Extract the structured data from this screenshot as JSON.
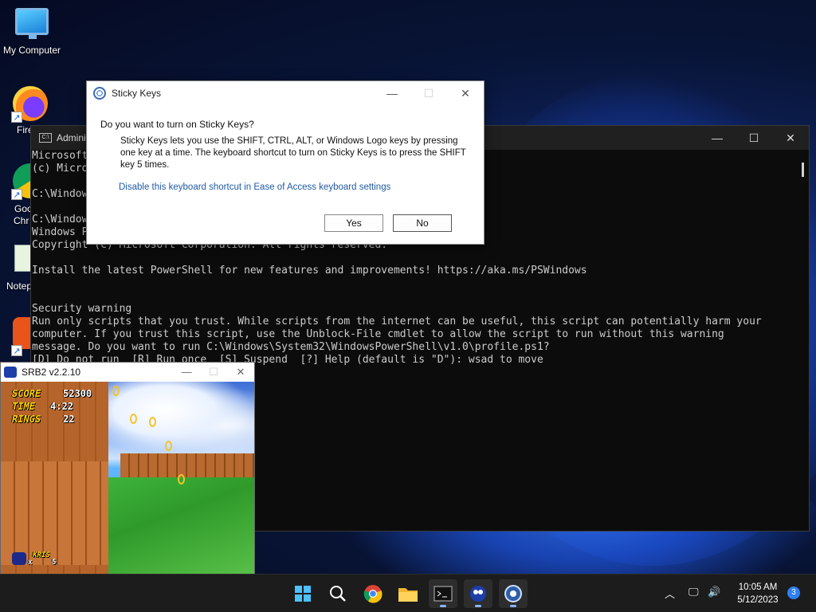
{
  "desktop": {
    "icons": [
      {
        "label": "My Computer"
      },
      {
        "label": "Fire"
      },
      {
        "label": "Goo"
      },
      {
        "label": "Chr"
      },
      {
        "label": "Notep"
      }
    ]
  },
  "terminal": {
    "title": "Admini",
    "lines": [
      "Microsoft",
      "(c) Micro",
      "",
      "C:\\Windows",
      "",
      "C:\\Window",
      "Windows P",
      "Copyright (C) Microsoft Corporation. All rights reserved.",
      "",
      "Install the latest PowerShell for new features and improvements! https://aka.ms/PSWindows",
      "",
      "",
      "Security warning",
      "Run only scripts that you trust. While scripts from the internet can be useful, this script can potentially harm your",
      "computer. If you trust this script, use the Unblock-File cmdlet to allow the script to run without this warning",
      "message. Do you want to run C:\\Windows\\System32\\WindowsPowerShell\\v1.0\\profile.ps1?",
      "[D] Do not run  [R] Run once  [S] Suspend  [?] Help (default is \"D\"): wsad to move"
    ]
  },
  "sticky_keys": {
    "title": "Sticky Keys",
    "question": "Do you want to turn on Sticky Keys?",
    "body": "Sticky Keys lets you use the SHIFT, CTRL, ALT, or Windows Logo keys by pressing one key at a time. The keyboard shortcut to turn on Sticky Keys is to press the SHIFT key 5 times.",
    "link": "Disable this keyboard shortcut in Ease of Access keyboard settings",
    "yes_label": "Yes",
    "no_label": "No"
  },
  "game": {
    "title": "SRB2 v2.2.10",
    "hud": {
      "score_label": "SCORE",
      "score": "52300",
      "time_label": "TIME",
      "time": "4:22",
      "rings_label": "RINGS",
      "rings": "22",
      "lives_name": "KRIS",
      "lives_x": "x",
      "lives": "5"
    }
  },
  "taskbar": {
    "apps": [
      "start-icon",
      "search-icon",
      "chrome-icon",
      "file-explorer-icon",
      "terminal-icon",
      "srb2-icon",
      "sticky-keys-icon"
    ],
    "time": "10:05 AM",
    "date": "5/12/2023",
    "notification_count": "3"
  }
}
